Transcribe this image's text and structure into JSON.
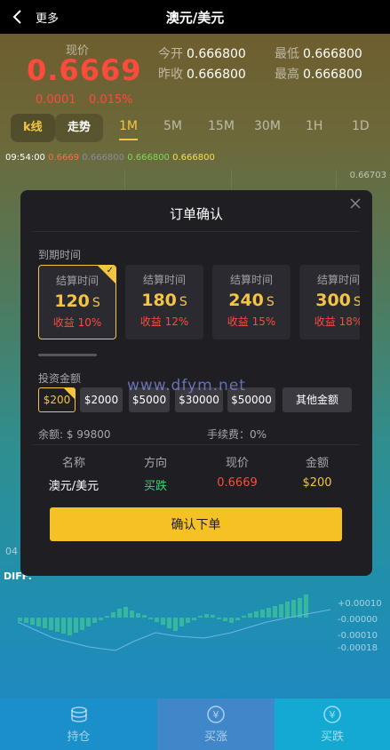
{
  "header": {
    "back_label": "更多",
    "title": "澳元/美元"
  },
  "quote": {
    "price_label": "现价",
    "price": "0.6669",
    "change": "0.0001",
    "change_pct": "0.015%",
    "open_label": "今开",
    "open": "0.666800",
    "prev_close_label": "昨收",
    "prev_close": "0.666800",
    "low_label": "最低",
    "low": "0.666800",
    "high_label": "最高",
    "high": "0.666800"
  },
  "tabs": {
    "kline": "k线",
    "trend": "走势",
    "periods": [
      "1M",
      "5M",
      "15M",
      "30M",
      "1H",
      "1D"
    ],
    "active_period": "1M"
  },
  "chart_info": {
    "time": "09:54:00",
    "ma1": "0.6669",
    "ma2": "0.666800",
    "ma3": "0.666800",
    "ma4": "0.666800",
    "y_top": "0.66703",
    "left_partial": "04",
    "diff_label": "DIFF:",
    "macd_labels": [
      "+0.00010",
      "-0.00000",
      "-0.00010",
      "-0.00018"
    ]
  },
  "modal": {
    "title": "订单确认",
    "expiry_label": "到期时间",
    "time_cards": [
      {
        "head": "结算时间",
        "value": "120",
        "unit": "S",
        "yield": "收益 10%"
      },
      {
        "head": "结算时间",
        "value": "180",
        "unit": "S",
        "yield": "收益 12%"
      },
      {
        "head": "结算时间",
        "value": "240",
        "unit": "S",
        "yield": "收益 15%"
      },
      {
        "head": "结算时间",
        "value": "300",
        "unit": "S",
        "yield": "收益 18%"
      }
    ],
    "amount_label": "投资金额",
    "amounts": [
      "$200",
      "$2000",
      "$5000",
      "$30000",
      "$50000"
    ],
    "other_amount": "其他金额",
    "balance": "余额: $ 99800",
    "fee": "手续费：0%",
    "summary_headers": [
      "名称",
      "方向",
      "现价",
      "金额"
    ],
    "summary_values": [
      "澳元/美元",
      "买跌",
      "0.6669",
      "$200"
    ],
    "confirm_label": "确认下单"
  },
  "watermark": "www.dfym.net",
  "bottom_nav": [
    {
      "label": "持仓",
      "icon": "coins-icon"
    },
    {
      "label": "买涨",
      "icon": "yen-up-icon"
    },
    {
      "label": "买跌",
      "icon": "yen-down-icon"
    }
  ],
  "colors": {
    "accent": "#f5c542",
    "up": "#ff4a3c",
    "down": "#3ad36a",
    "macd_bar": "#38b7a0"
  }
}
